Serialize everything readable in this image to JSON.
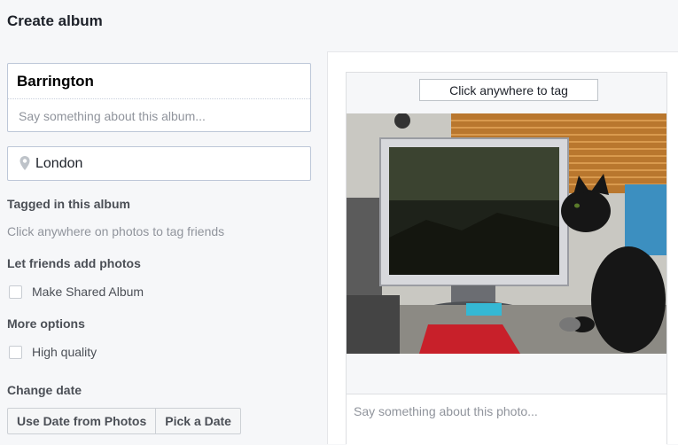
{
  "header": {
    "title": "Create album"
  },
  "album": {
    "name_value": "Barrington",
    "description_placeholder": "Say something about this album..."
  },
  "location": {
    "value": "London",
    "icon": "location-pin-icon"
  },
  "tagged": {
    "heading": "Tagged in this album",
    "hint": "Click anywhere on photos to tag friends"
  },
  "friends": {
    "heading": "Let friends add photos",
    "shared_label": "Make Shared Album",
    "shared_checked": false
  },
  "more_options": {
    "heading": "More options",
    "quality_label": "High quality",
    "quality_checked": false
  },
  "change_date": {
    "heading": "Change date",
    "use_date_label": "Use Date from Photos",
    "pick_date_label": "Pick a Date"
  },
  "photo": {
    "tag_button_label": "Click anywhere to tag",
    "caption_placeholder": "Say something about this photo..."
  },
  "colors": {
    "page_bg": "#f6f7f9",
    "border": "#bdc7d8",
    "muted_text": "#90949c"
  }
}
